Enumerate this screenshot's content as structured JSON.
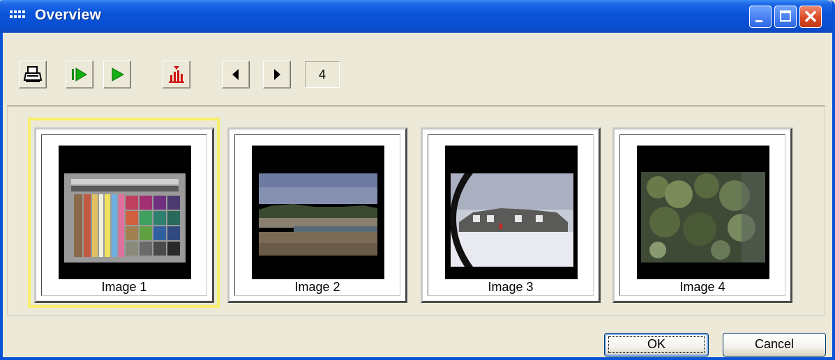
{
  "window": {
    "title": "Overview",
    "title_bar_color": "#0a53d6"
  },
  "caption_buttons": [
    {
      "name": "minimize",
      "icon": "minimize-icon"
    },
    {
      "name": "maximize",
      "icon": "maximize-icon"
    },
    {
      "name": "close",
      "icon": "close-icon",
      "glyph": "✕"
    }
  ],
  "toolbar": {
    "buttons": [
      {
        "name": "print",
        "icon": "printer-icon"
      },
      {
        "name": "play-from-start",
        "icon": "play-from-start-icon"
      },
      {
        "name": "play",
        "icon": "play-icon"
      },
      {
        "name": "histogram",
        "icon": "histogram-icon"
      },
      {
        "name": "previous",
        "icon": "arrow-left-icon"
      },
      {
        "name": "next",
        "icon": "arrow-right-icon"
      }
    ],
    "page_count": "4"
  },
  "thumbnails": [
    {
      "label": "Image 1",
      "selected": true,
      "content": "color chart"
    },
    {
      "label": "Image 2",
      "selected": false,
      "content": "beach landscape"
    },
    {
      "label": "Image 3",
      "selected": false,
      "content": "harbor scene, rotated"
    },
    {
      "label": "Image 4",
      "selected": false,
      "content": "foliage"
    }
  ],
  "selection_color": "#f7f06a",
  "buttons": {
    "ok_label": "OK",
    "cancel_label": "Cancel"
  }
}
